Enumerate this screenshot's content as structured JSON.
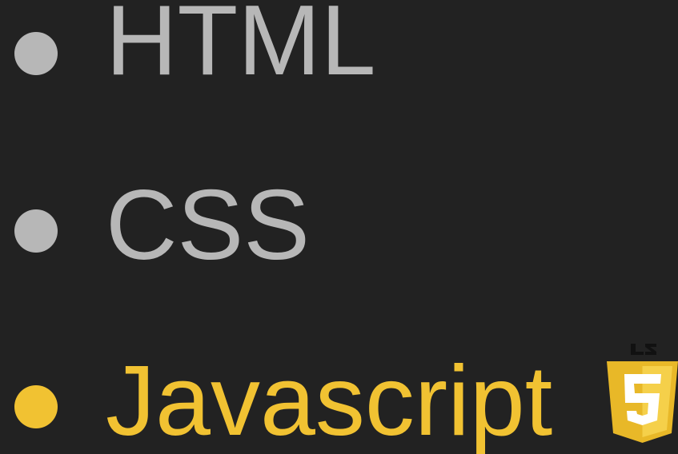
{
  "list": {
    "items": [
      {
        "label": "HTML",
        "state": "muted"
      },
      {
        "label": "CSS",
        "state": "muted"
      },
      {
        "label": "Javascript",
        "state": "active"
      }
    ]
  },
  "logo": {
    "icon": "js-shield-icon",
    "text": "JS"
  },
  "colors": {
    "background": "#222222",
    "muted": "#b7b7b7",
    "accent": "#f1c232",
    "logo_shield": "#f0db4f",
    "logo_inner": "#ffe066"
  }
}
